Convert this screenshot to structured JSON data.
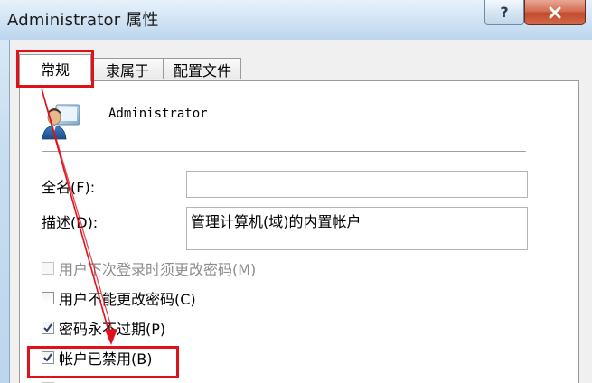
{
  "window": {
    "title": "Administrator 属性",
    "help_label": "?",
    "close_icon": "close-icon"
  },
  "tabs": [
    {
      "label": "常规",
      "active": true
    },
    {
      "label": "隶属于",
      "active": false
    },
    {
      "label": "配置文件",
      "active": false
    }
  ],
  "general": {
    "account_name": "Administrator",
    "user_icon": "user-icon",
    "full_name": {
      "label": "全名(F):",
      "value": ""
    },
    "description": {
      "label": "描述(D):",
      "value": "管理计算机(域)的内置帐户"
    },
    "options": [
      {
        "label": "用户下次登录时须更改密码(M)",
        "checked": false,
        "enabled": false
      },
      {
        "label": "用户不能更改密码(C)",
        "checked": false,
        "enabled": true
      },
      {
        "label": "密码永不过期(P)",
        "checked": true,
        "enabled": true
      },
      {
        "label": "帐户已禁用(B)",
        "checked": true,
        "enabled": true
      }
    ]
  },
  "colors": {
    "annotation": "#e0111a",
    "close_button": "#c44a2c"
  }
}
